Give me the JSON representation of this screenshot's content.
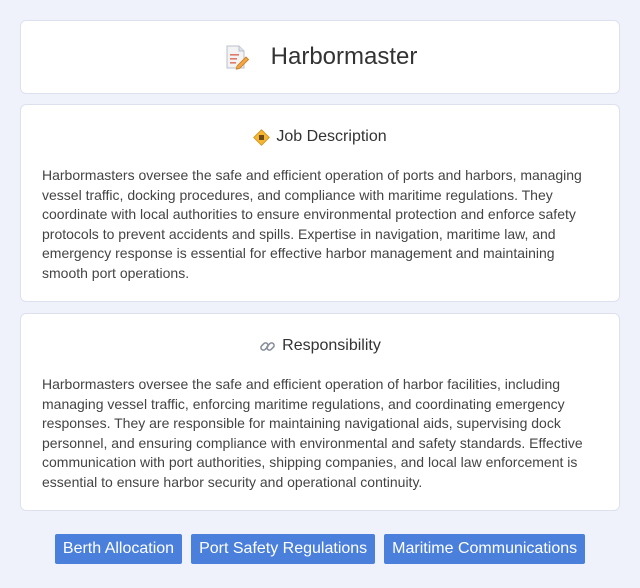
{
  "header": {
    "title": "Harbormaster",
    "icon": "document-pencil-icon"
  },
  "job_description": {
    "heading": "Job Description",
    "icon": "diamond-badge-icon",
    "text": "Harbormasters oversee the safe and efficient operation of ports and harbors, managing vessel traffic, docking procedures, and compliance with maritime regulations. They coordinate with local authorities to ensure environmental protection and enforce safety protocols to prevent accidents and spills. Expertise in navigation, maritime law, and emergency response is essential for effective harbor management and maintaining smooth port operations."
  },
  "responsibility": {
    "heading": "Responsibility",
    "icon": "link-icon",
    "text": "Harbormasters oversee the safe and efficient operation of harbor facilities, including managing vessel traffic, enforcing maritime regulations, and coordinating emergency responses. They are responsible for maintaining navigational aids, supervising dock personnel, and ensuring compliance with environmental and safety standards. Effective communication with port authorities, shipping companies, and local law enforcement is essential to ensure harbor security and operational continuity."
  },
  "tags": [
    "Berth Allocation",
    "Port Safety Regulations",
    "Maritime Communications"
  ],
  "colors": {
    "background": "#f0f2fb",
    "tag_bg": "#4a7fdc",
    "card_bg": "#ffffff"
  }
}
